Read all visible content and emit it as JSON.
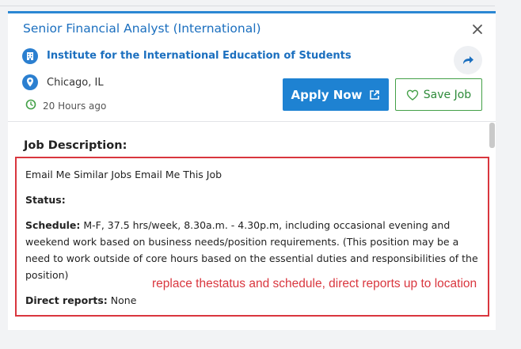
{
  "job": {
    "title": "Senior Financial Analyst (International)",
    "company": "Institute for the International Education of Students",
    "location": "Chicago, IL",
    "posted": "20 Hours ago"
  },
  "actions": {
    "apply_label": "Apply Now",
    "save_label": "Save Job"
  },
  "description": {
    "heading": "Job Description:",
    "line1": "Email Me Similar Jobs Email Me This Job",
    "status_label": "Status:",
    "status_value": "",
    "schedule_label": "Schedule:",
    "schedule_value": " M-F, 37.5 hrs/week, 8.30a.m. - 4.30p.m, including occasional evening and weekend work based on business needs/position requirements. (This position may be a need to work outside of core hours based on the essential duties and responsibilities of the position)",
    "direct_reports_label": "Direct reports:",
    "direct_reports_value": " None"
  },
  "annotation": {
    "text": "replace thestatus and schedule, direct reports up to location",
    "color": "#d9363e"
  },
  "colors": {
    "accent": "#1e82d2",
    "link": "#1b6fbf",
    "save_green": "#2e8b3a"
  },
  "icons": [
    "close-icon",
    "building-icon",
    "location-pin-icon",
    "clock-icon",
    "share-icon",
    "external-link-icon",
    "heart-icon"
  ]
}
